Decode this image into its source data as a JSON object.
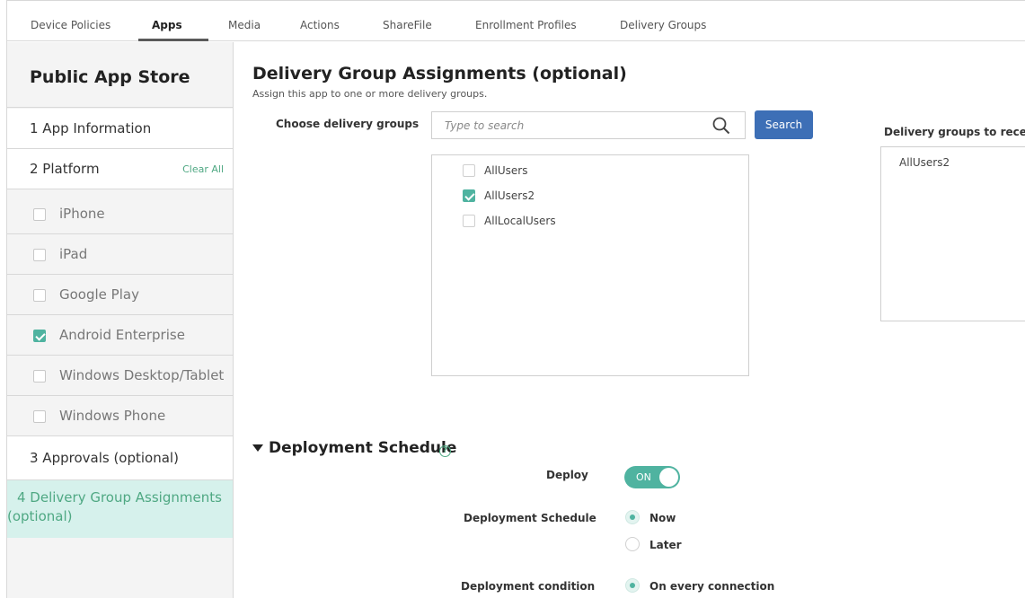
{
  "tabs": {
    "items": [
      "Device Policies",
      "Apps",
      "Media",
      "Actions",
      "ShareFile",
      "Enrollment Profiles",
      "Delivery Groups"
    ],
    "active": "Apps"
  },
  "sidebar": {
    "title": "Public App Store",
    "step1": "1  App Information",
    "step2": "2  Platform",
    "clear_all": "Clear All",
    "platforms": [
      {
        "label": "iPhone",
        "checked": false
      },
      {
        "label": "iPad",
        "checked": false
      },
      {
        "label": "Google Play",
        "checked": false
      },
      {
        "label": "Android Enterprise",
        "checked": true
      },
      {
        "label": "Windows Desktop/Tablet",
        "checked": false
      },
      {
        "label": "Windows Phone",
        "checked": false
      }
    ],
    "step3": "3  Approvals (optional)",
    "step4_line1": "4  Delivery Group Assignments",
    "step4_line2": "(optional)"
  },
  "main": {
    "heading": "Delivery Group Assignments (optional)",
    "subheading": "Assign this app to one or more delivery groups.",
    "choose_label": "Choose delivery groups",
    "search_placeholder": "Type to search",
    "search_button": "Search",
    "groups": [
      {
        "label": "AllUsers",
        "checked": false
      },
      {
        "label": "AllUsers2",
        "checked": true
      },
      {
        "label": "AllLocalUsers",
        "checked": false
      }
    ],
    "receive_label": "Delivery groups to receive",
    "receive_items": [
      "AllUsers2"
    ]
  },
  "deployment": {
    "title": "Deployment Schedule",
    "help": "?",
    "deploy_label": "Deploy",
    "deploy_toggle": "ON",
    "schedule_label": "Deployment Schedule",
    "schedule_options": [
      {
        "label": "Now",
        "selected": true
      },
      {
        "label": "Later",
        "selected": false
      }
    ],
    "condition_label": "Deployment condition",
    "condition_option": "On every connection"
  },
  "colors": {
    "accent": "#4fb3a0",
    "primary_button": "#3d6fb6",
    "active_nav_bg": "#d6f1ec"
  }
}
